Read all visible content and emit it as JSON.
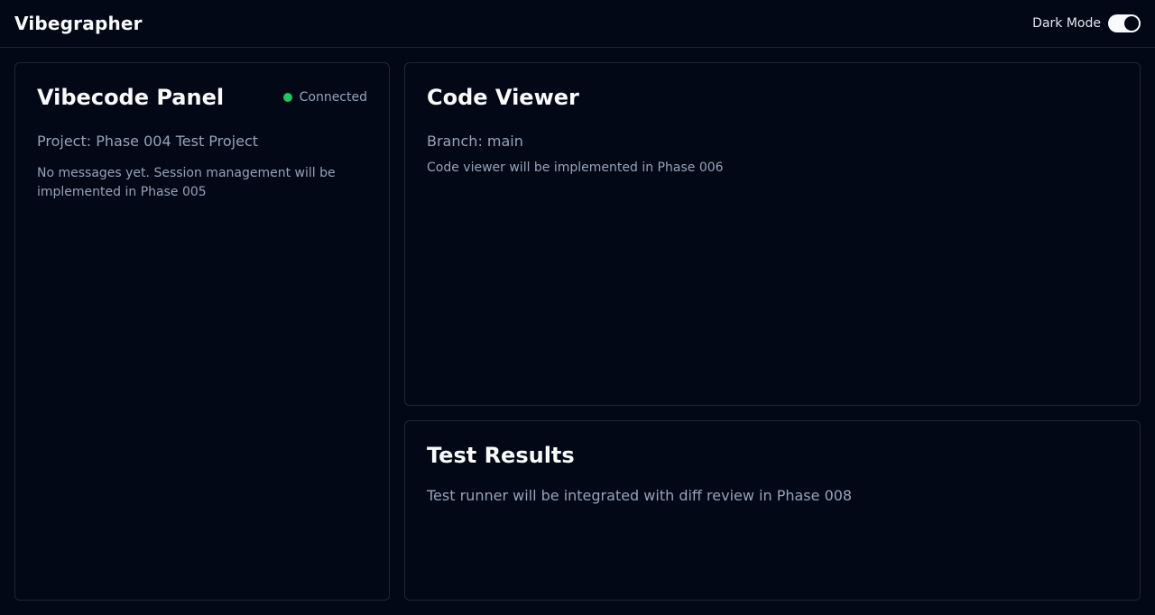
{
  "header": {
    "title": "Vibegrapher",
    "dark_mode_label": "Dark Mode",
    "dark_mode_enabled": true
  },
  "vibecode_panel": {
    "title": "Vibecode Panel",
    "status": "Connected",
    "status_color": "#22c55e",
    "project_label": "Project: Phase 004 Test Project",
    "empty_message": "No messages yet. Session management will be implemented in Phase 005"
  },
  "code_viewer": {
    "title": "Code Viewer",
    "branch_label": "Branch: main",
    "placeholder": "Code viewer will be implemented in Phase 006"
  },
  "test_results": {
    "title": "Test Results",
    "placeholder": "Test runner will be integrated with diff review in Phase 008"
  }
}
